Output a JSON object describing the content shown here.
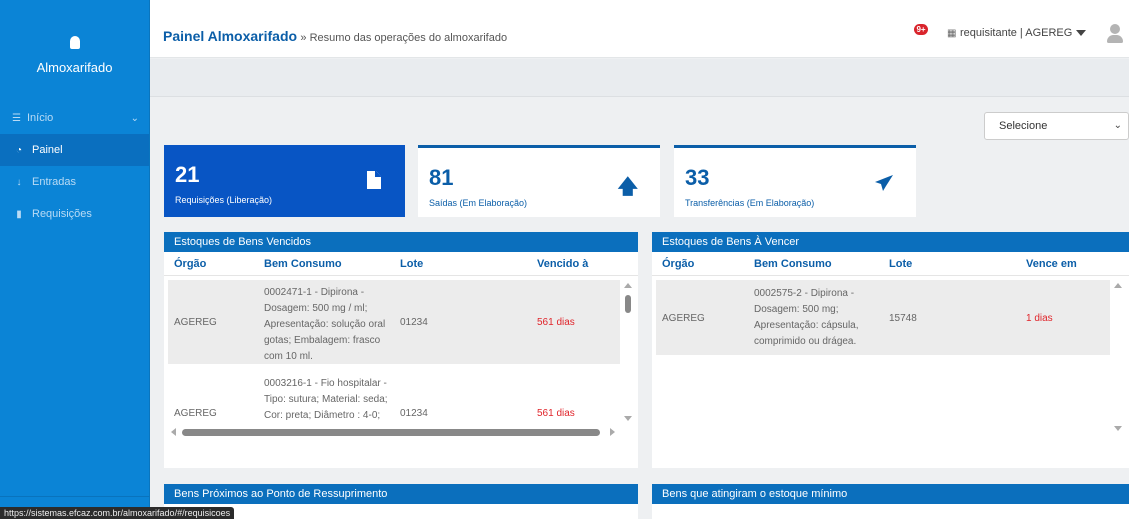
{
  "sidebar": {
    "brand": "Almoxarifado",
    "items": [
      {
        "label": "Início",
        "icon": "list-icon"
      },
      {
        "label": "Painel",
        "icon": "dashboard-icon"
      },
      {
        "label": "Entradas",
        "icon": "arrow-down-icon"
      },
      {
        "label": "Requisições",
        "icon": "file-icon"
      }
    ]
  },
  "header": {
    "title": "Painel Almoxarifado",
    "subtitle": "» Resumo das operações do almoxarifado",
    "notification_badge": "9+",
    "user": "requisitante | AGEREG"
  },
  "filter": {
    "selected": "Selecione"
  },
  "stats": [
    {
      "value": "21",
      "label": "Requisições (Liberação)",
      "icon": "document-icon"
    },
    {
      "value": "81",
      "label": "Saídas (Em Elaboração)",
      "icon": "arrow-up-icon"
    },
    {
      "value": "33",
      "label": "Transferências (Em Elaboração)",
      "icon": "paper-plane-icon"
    }
  ],
  "panels": {
    "vencidos": {
      "title": "Estoques de Bens Vencidos",
      "columns": [
        "Órgão",
        "Bem Consumo",
        "Lote",
        "Vencido à"
      ],
      "rows": [
        {
          "orgao": "AGEREG",
          "bem": "0002471-1 - Dipirona - Dosagem: 500 mg / ml; Apresentação: solução oral gotas; Embalagem: frasco com 10 ml.",
          "lote": "01234",
          "prazo": "561 dias"
        },
        {
          "orgao": "AGEREG",
          "bem": "0003216-1 - Fio hospitalar - Tipo: sutura; Material: seda; Cor: preta; Diâmetro : 4-0;",
          "lote": "01234",
          "prazo": "561 dias"
        }
      ]
    },
    "a_vencer": {
      "title": "Estoques de Bens À Vencer",
      "columns": [
        "Órgão",
        "Bem Consumo",
        "Lote",
        "Vence em"
      ],
      "rows": [
        {
          "orgao": "AGEREG",
          "bem": "0002575-2 - Dipirona - Dosagem: 500 mg; Apresentação: cápsula, comprimido ou drágea.",
          "lote": "15748",
          "prazo": "1 dias"
        }
      ]
    },
    "ressuprimento": {
      "title": "Bens Próximos ao Ponto de Ressuprimento"
    },
    "estoque_minimo": {
      "title": "Bens que atingiram o estoque mínimo"
    }
  },
  "statusbar": {
    "url": "https://sistemas.efcaz.com.br/almoxarifado/#/requisicoes"
  },
  "colors": {
    "primary": "#0b84d6",
    "dark_blue": "#0855c4",
    "header_blue": "#0b6fbd",
    "danger": "#e0252b"
  }
}
